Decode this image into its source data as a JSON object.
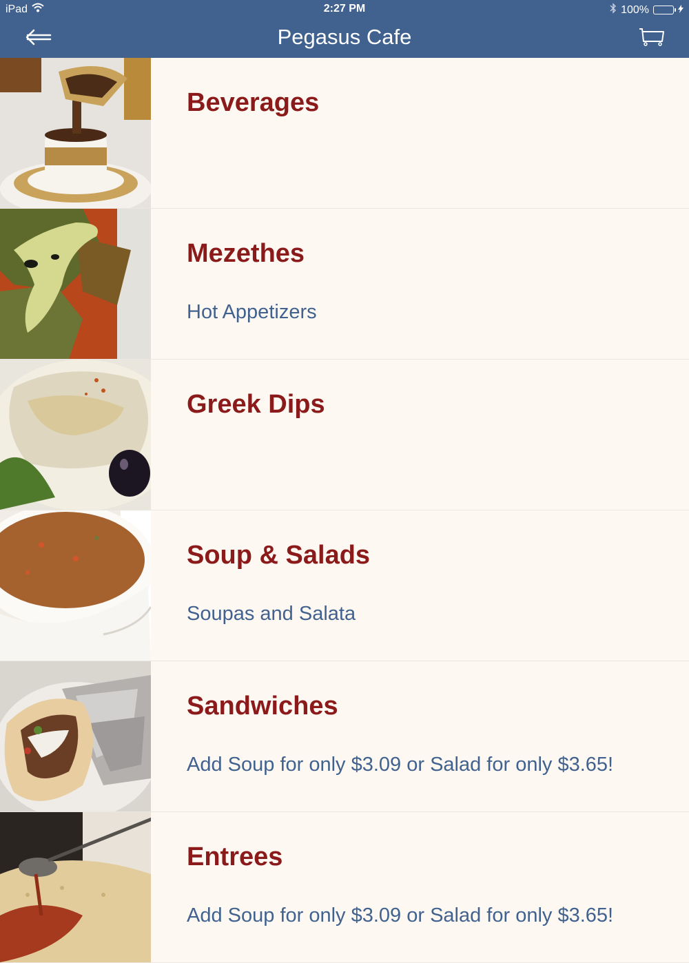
{
  "status_bar": {
    "device": "iPad",
    "time": "2:27 PM",
    "battery": "100%",
    "icons": [
      "wifi-icon",
      "bluetooth-icon",
      "battery-icon"
    ]
  },
  "nav": {
    "title": "Pegasus Cafe",
    "back_icon": "back-arrow-icon",
    "cart_icon": "cart-icon"
  },
  "categories": [
    {
      "title": "Beverages",
      "subtitle": ""
    },
    {
      "title": "Mezethes",
      "subtitle": "Hot Appetizers"
    },
    {
      "title": "Greek Dips",
      "subtitle": ""
    },
    {
      "title": "Soup & Salads",
      "subtitle": "Soupas and Salata"
    },
    {
      "title": "Sandwiches",
      "subtitle": "Add Soup for only $3.09 or Salad for only $3.65!"
    },
    {
      "title": "Entrees",
      "subtitle": "Add Soup for only $3.09 or Salad for only $3.65!"
    }
  ],
  "colors": {
    "header": "#41628f",
    "title": "#8b1a1a",
    "subtitle": "#41628f",
    "background": "#fdf8f2"
  }
}
